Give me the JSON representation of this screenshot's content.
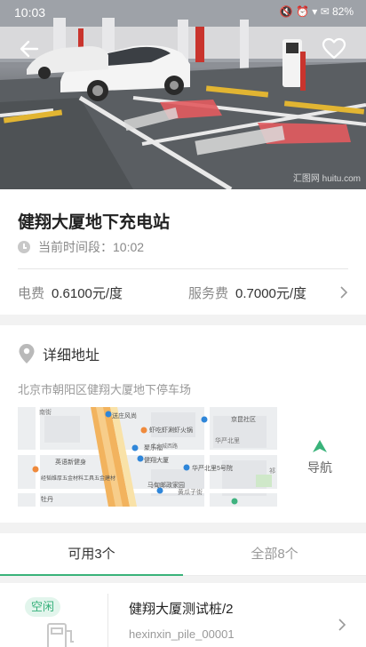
{
  "status_bar": {
    "time": "10:03",
    "right": "🔇 ⏰ ▾ ✉ 82%"
  },
  "hero": {
    "watermark": "汇图网 huitu.com"
  },
  "station": {
    "name": "健翔大厦地下充电站",
    "time_label": "当前时间段：10:02"
  },
  "price": {
    "electric_label": "电费",
    "electric_value": "0.6100元/度",
    "service_label": "服务费",
    "service_value": "0.7000元/度"
  },
  "address": {
    "heading": "详细地址",
    "text": "北京市朝阳区健翔大厦地下停车场",
    "map_labels": {
      "poi1": "送庄风尚",
      "poi2": "虾吃虾涮虾火锅",
      "poi3": "聚乐福",
      "poi4": "健翔大厦",
      "poi5": "马甸邮政家园",
      "poi6": "华严北里5号院",
      "poi7": "英语新健身",
      "poi8": "经韬维厚五金材料工具五金建材",
      "poi9": "牡丹",
      "poi10": "京昆社区",
      "road1": "南街",
      "road2": "华严北里",
      "road3": "北土城西路",
      "road4": "黄瓜子街",
      "road5": "祁"
    },
    "nav_label": "导航"
  },
  "tabs": {
    "available": "可用3个",
    "all": "全部8个"
  },
  "piles": [
    {
      "status": "空闲",
      "name": "健翔大厦测试桩/2",
      "code": "hexinxin_pile_00001"
    }
  ],
  "colors": {
    "accent": "#39b37a",
    "badge_bg": "#e2f5ec"
  }
}
